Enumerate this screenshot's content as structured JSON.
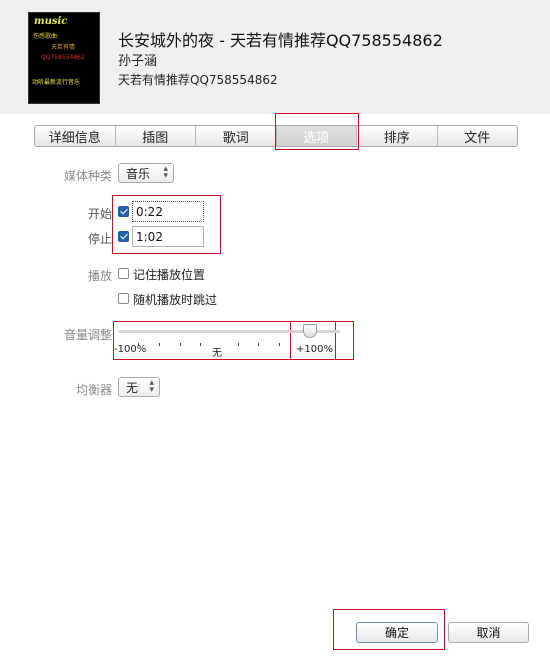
{
  "header": {
    "title": "长安城外的夜 - 天若有情推荐QQ758554862",
    "artist": "孙子涵",
    "album": "天若有情推荐QQ758554862",
    "art": {
      "line0": "music",
      "line1": "伤感歌曲·",
      "line2": "天若有情",
      "line3": "QQ758554862",
      "line4": "",
      "line5": "动听最新流行音乐"
    }
  },
  "tabs": [
    "详细信息",
    "插图",
    "歌词",
    "选项",
    "排序",
    "文件"
  ],
  "selected_tab": "选项",
  "options": {
    "media_kind": {
      "label": "媒体种类",
      "value": "音乐"
    },
    "start": {
      "label": "开始",
      "checked": true,
      "value": "0:22"
    },
    "stop": {
      "label": "停止",
      "checked": true,
      "value": "1:02"
    },
    "playback": {
      "label": "播放",
      "remember_position": {
        "text": "记住播放位置",
        "checked": false
      },
      "skip_shuffle": {
        "text": "随机播放时跳过",
        "checked": false
      }
    },
    "volume": {
      "label": "音量调整",
      "min_label": "-100%",
      "mid_label": "无",
      "max_label": "+100%",
      "value_fraction": 0.85
    },
    "equalizer": {
      "label": "均衡器",
      "value": "无"
    }
  },
  "buttons": {
    "ok": "确定",
    "cancel": "取消"
  },
  "colors": {
    "highlight": "#c8101e",
    "checkbox": "#2a5ea8"
  }
}
